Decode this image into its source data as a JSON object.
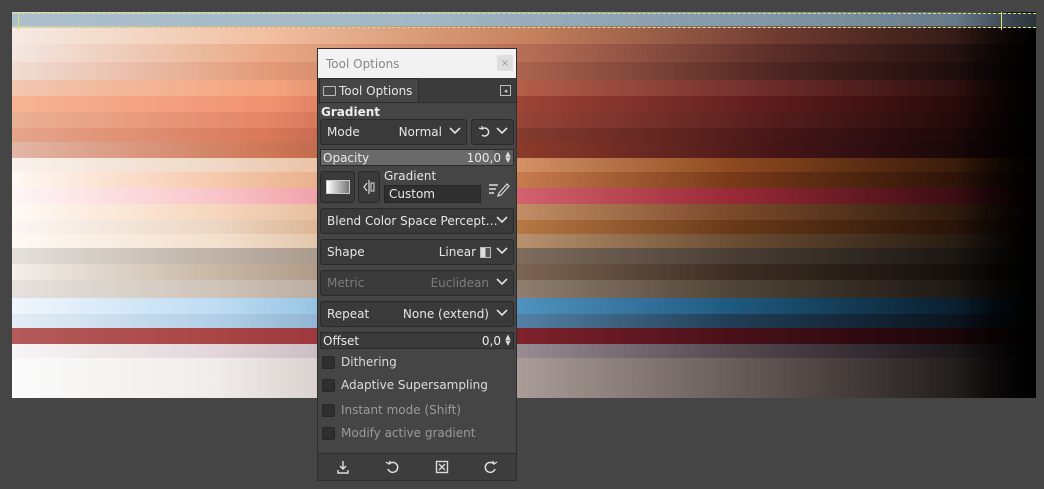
{
  "window": {
    "title": "Tool Options",
    "close_glyph": "×"
  },
  "tabs": [
    {
      "label": "Tool Options",
      "icon": "tool-options-icon"
    }
  ],
  "tab_menu_glyph": "◂",
  "group": {
    "title": "Gradient"
  },
  "mode": {
    "label": "Mode",
    "value": "Normal"
  },
  "opacity": {
    "label": "Opacity",
    "value": "100,0",
    "level": 0.9
  },
  "gradient": {
    "label": "Gradient",
    "value": "Custom"
  },
  "blend_color_space": {
    "label": "Blend Color Space Percept…"
  },
  "shape": {
    "label": "Shape",
    "value": "Linear"
  },
  "metric": {
    "label": "Metric",
    "value": "Euclidean"
  },
  "repeat": {
    "label": "Repeat",
    "value": "None (extend)"
  },
  "offset": {
    "label": "Offset",
    "value": "0,0"
  },
  "checkboxes": [
    {
      "label": "Dithering",
      "enabled": true
    },
    {
      "label": "Adaptive Supersampling",
      "enabled": true
    },
    {
      "label": "Instant mode  (Shift)",
      "enabled": false
    },
    {
      "label": "Modify active gradient",
      "enabled": false
    }
  ],
  "colors": {
    "canvas_bg": "#454545",
    "panel_bg": "#454545",
    "titlebar_bg": "#f2f2f2",
    "selection": "#e5e070"
  }
}
